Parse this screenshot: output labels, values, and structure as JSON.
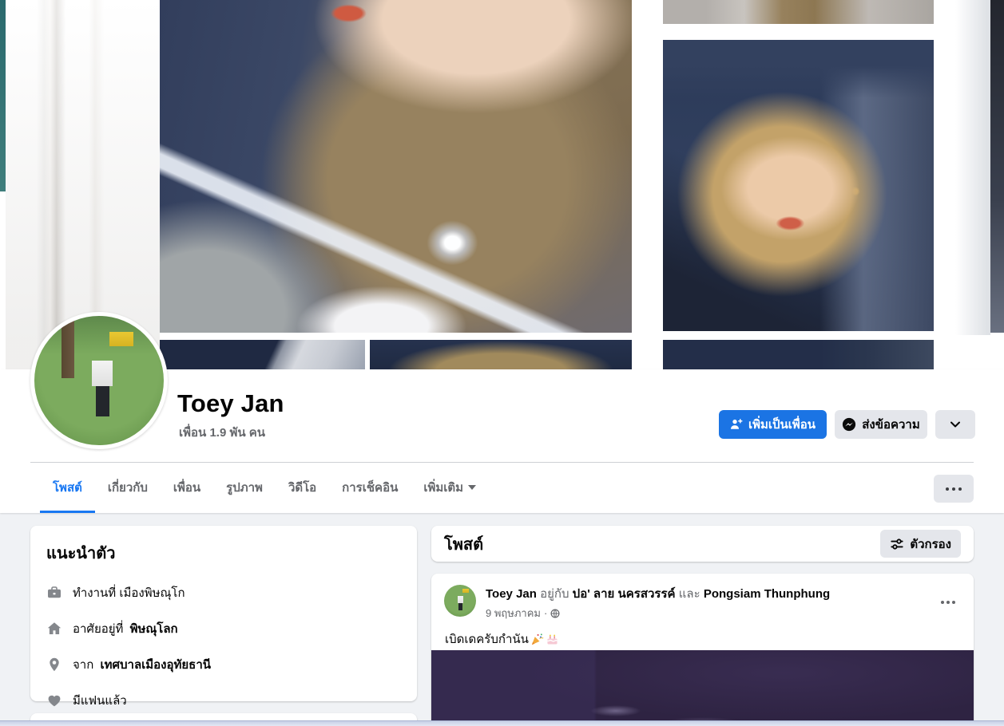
{
  "colors": {
    "accent_blue": "#1b74e4",
    "active_tab_blue": "#1877f2",
    "page_bg": "#f0f2f5",
    "surface": "#ffffff",
    "text_primary": "#050505",
    "text_secondary": "#65676b",
    "button_gray": "#e4e6eb",
    "icon_gray": "#84878c",
    "post_image_purple": "#2e2342"
  },
  "profile": {
    "name": "Toey Jan",
    "friends_count": "เพื่อน 1.9 พัน คน",
    "add_friend_button": "เพิ่มเป็นเพื่อน",
    "add_friend_icon": "person-add-icon",
    "message_button": "ส่งข้อความ",
    "message_icon": "messenger-icon",
    "more_actions_icon": "chevron-down-icon"
  },
  "tabs": [
    {
      "label": "โพสต์",
      "active": true
    },
    {
      "label": "เกี่ยวกับ",
      "active": false
    },
    {
      "label": "เพื่อน",
      "active": false
    },
    {
      "label": "รูปภาพ",
      "active": false
    },
    {
      "label": "วิดีโอ",
      "active": false
    },
    {
      "label": "การเช็คอิน",
      "active": false
    },
    {
      "label": "เพิ่มเติม",
      "active": false,
      "dropdown": true
    }
  ],
  "tabs_more_icon": "ellipsis-icon",
  "intro": {
    "title": "แนะนำตัว",
    "work": {
      "icon": "briefcase-icon",
      "text": "ทำงานที่ เมืองพิษณุโก"
    },
    "lives": {
      "icon": "home-icon",
      "prefix": "อาศัยอยู่ที่",
      "bold": "พิษณุโลก"
    },
    "from": {
      "icon": "location-pin-icon",
      "prefix": "จาก",
      "bold": "เทศบาลเมืองอุทัยธานี"
    },
    "relationship": {
      "icon": "heart-icon",
      "text": "มีแฟนแล้ว"
    }
  },
  "posts_header": {
    "title": "โพสต์",
    "filter_button": "ตัวกรอง",
    "filter_icon": "filter-sliders-icon"
  },
  "post": {
    "author": "Toey Jan",
    "connector_with": "อยู่กับ",
    "tagged_person_1": "ปอ' ลาย นครสวรรค์",
    "connector_and": "และ",
    "tagged_person_2": "Pongsiam Thunphung",
    "timestamp": "9 พฤษภาคม",
    "separator": "·",
    "privacy_icon": "globe-icon",
    "menu_icon": "ellipsis-icon",
    "text": "เบิดเดครับกำนัน",
    "emoji_icons": [
      "party-popper-emoji",
      "birthday-cake-emoji"
    ]
  }
}
